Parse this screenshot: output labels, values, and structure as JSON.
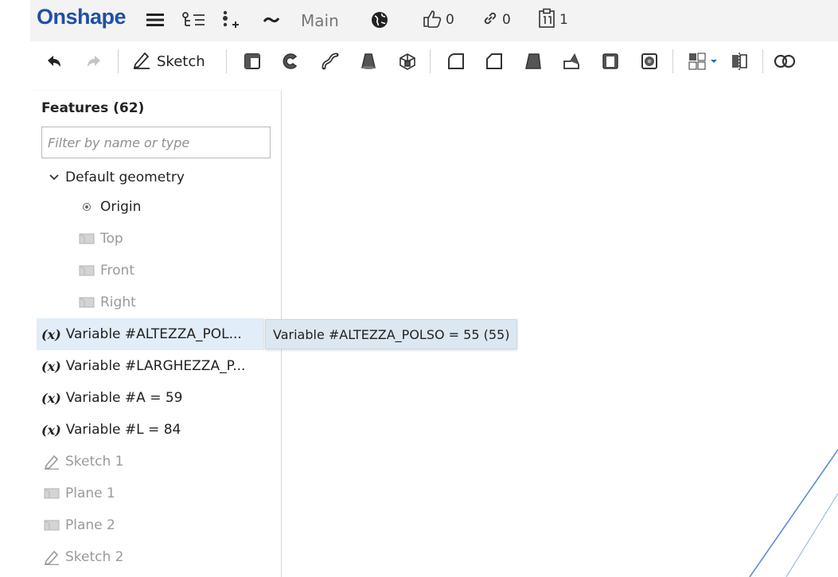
{
  "app": {
    "logo_text": "Onshape",
    "branch_label": "Main",
    "likes_count": "0",
    "links_count": "0",
    "versions_count": "1"
  },
  "toolbar": {
    "sketch_label": "Sketch"
  },
  "feature_panel": {
    "title": "Features (62)",
    "filter_placeholder": "Filter by name or type",
    "default_geometry_label": "Default geometry",
    "default_geometry_items": [
      {
        "label": "Origin",
        "icon": "origin-icon"
      },
      {
        "label": "Top",
        "icon": "plane-icon"
      },
      {
        "label": "Front",
        "icon": "plane-icon"
      },
      {
        "label": "Right",
        "icon": "plane-icon"
      }
    ],
    "features": [
      {
        "label": "Variable #ALTEZZA_POL...",
        "icon": "variable-icon",
        "icon_text": "(x)"
      },
      {
        "label": "Variable #LARGHEZZA_P...",
        "icon": "variable-icon",
        "icon_text": "(x)"
      },
      {
        "label": "Variable #A = 59",
        "icon": "variable-icon",
        "icon_text": "(x)"
      },
      {
        "label": "Variable #L = 84",
        "icon": "variable-icon",
        "icon_text": "(x)"
      },
      {
        "label": "Sketch 1",
        "icon": "sketch-icon"
      },
      {
        "label": "Plane 1",
        "icon": "plane-icon"
      },
      {
        "label": "Plane 2",
        "icon": "plane-icon"
      },
      {
        "label": "Sketch 2",
        "icon": "sketch-icon"
      }
    ]
  },
  "tooltip": {
    "text": "Variable #ALTEZZA_POLSO = 55 (55)"
  },
  "colors": {
    "brand": "#1f4fa8",
    "selection": "#e1edf8",
    "tooltip_bg": "#dbe7f1",
    "geometry_edge": "#5d8dd6"
  }
}
